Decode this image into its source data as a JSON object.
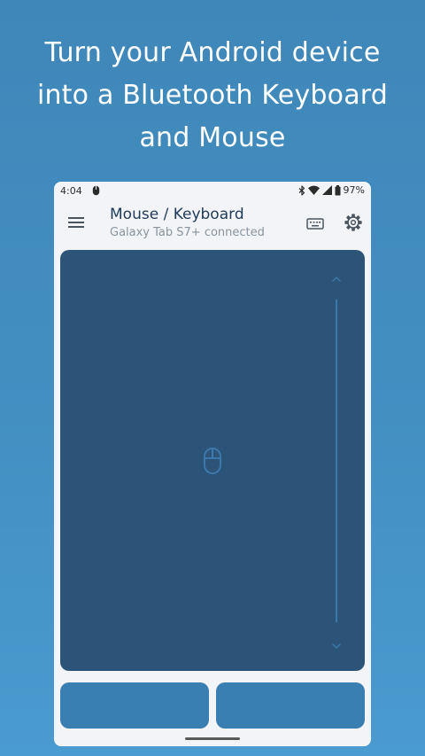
{
  "headline": {
    "line1": "Turn your Android device",
    "line2": "into a Bluetooth Keyboard",
    "line3": "and Mouse"
  },
  "status_bar": {
    "time": "4:04",
    "battery": "97%",
    "icons": [
      "mouse-icon",
      "bluetooth-icon",
      "wifi-icon",
      "signal-icon",
      "battery-icon"
    ]
  },
  "app_bar": {
    "title": "Mouse / Keyboard",
    "subtitle": "Galaxy Tab S7+ connected",
    "icons": [
      "menu-icon",
      "keyboard-icon",
      "settings-icon"
    ]
  },
  "touchpad": {
    "icons": [
      "mouse-icon",
      "chevron-up-icon",
      "chevron-down-icon"
    ]
  },
  "colors": {
    "background": "#438fc2",
    "phone_surface": "#f3f4f7",
    "touchpad": "#2c5478",
    "buttons": "#3a7fb2",
    "scroll_accent": "#3d78aa",
    "title_text": "#1f3a58",
    "subtitle_text": "#8a949e"
  }
}
